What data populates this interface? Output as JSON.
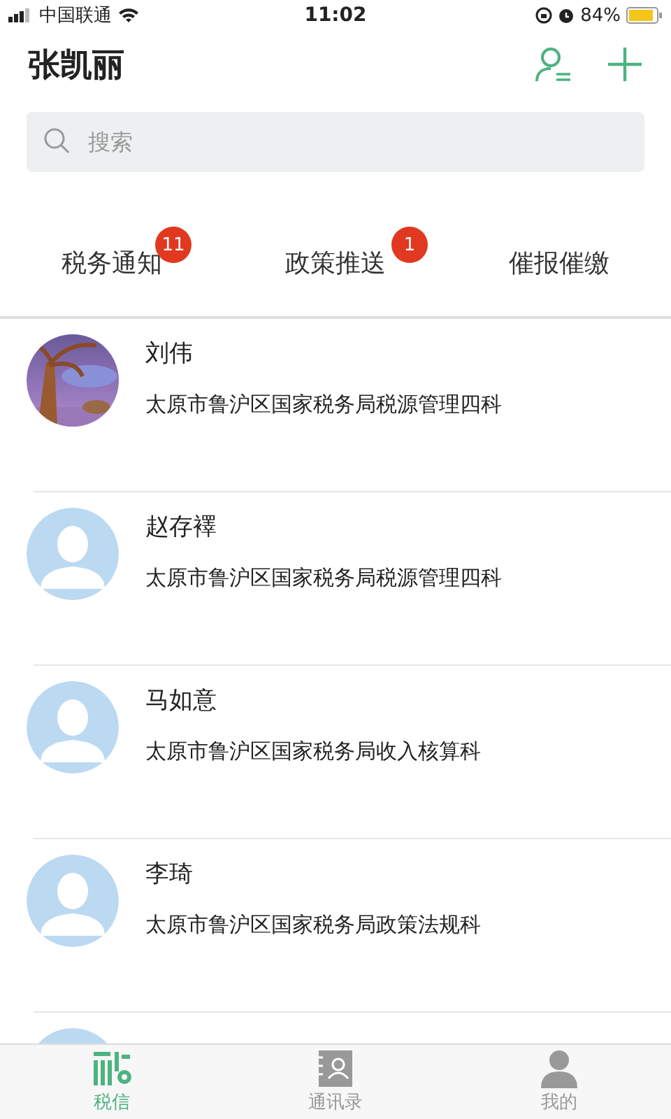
{
  "status_bar": {
    "carrier": "中国联通",
    "time": "11:02",
    "battery": "84%"
  },
  "header": {
    "title": "张凯丽"
  },
  "search": {
    "placeholder": "搜索"
  },
  "tabs": [
    {
      "label": "税务通知",
      "badge": "11"
    },
    {
      "label": "政策推送",
      "badge": "1"
    },
    {
      "label": "催报催缴"
    }
  ],
  "contacts": [
    {
      "name": "刘伟",
      "department": "太原市鲁沪区国家税务局税源管理四科",
      "kind": "picture"
    },
    {
      "name": "赵存襗",
      "department": "太原市鲁沪区国家税务局税源管理四科",
      "kind": "default"
    },
    {
      "name": "马如意",
      "department": "太原市鲁沪区国家税务局收入核算科",
      "kind": "default"
    },
    {
      "name": "李琦",
      "department": "太原市鲁沪区国家税务局政策法规科",
      "kind": "default"
    },
    {
      "kind": "default"
    }
  ],
  "tab_bar": [
    {
      "label": "税信",
      "selected": true
    },
    {
      "label": "通讯录",
      "selected": false
    },
    {
      "label": "我的",
      "selected": false
    }
  ]
}
